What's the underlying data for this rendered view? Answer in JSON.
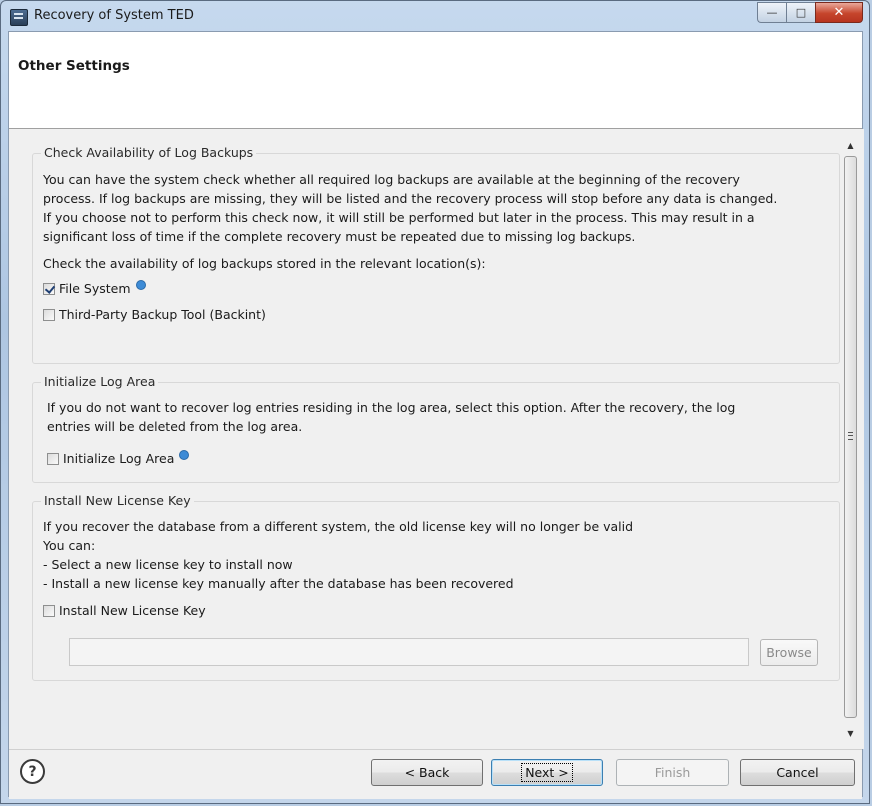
{
  "window": {
    "title": "Recovery of System TED",
    "icon": "database-app-icon"
  },
  "header": {
    "title": "Other Settings"
  },
  "groups": [
    {
      "legend": "Check Availability of Log Backups",
      "description_lines": [
        "You can have the system check whether all required log backups are available at the beginning of the recovery",
        "process. If log backups are missing, they will be listed and the recovery process will stop before any data is changed.",
        "If you choose not to perform this check now, it will still be performed but later in the process. This may result in a",
        "significant loss of time if the complete recovery must be repeated due to missing log backups."
      ],
      "prompt": "Check the availability of log backups stored in the relevant location(s):",
      "options": [
        {
          "label": "File System",
          "checked": true,
          "has_info_icon": true
        },
        {
          "label": "Third-Party Backup Tool (Backint)",
          "checked": false,
          "has_info_icon": false
        }
      ]
    },
    {
      "legend": "Initialize Log Area",
      "description_lines": [
        "If you do not want to recover log entries residing in the log area, select this option. After the recovery, the log",
        "entries will be deleted from the log area."
      ],
      "options": [
        {
          "label": "Initialize Log Area",
          "checked": false,
          "has_info_icon": true
        }
      ]
    },
    {
      "legend": "Install New License Key",
      "description_lines": [
        "If you recover the database from a different system, the old license key will no longer be valid",
        "You can:",
        "- Select a new license key to install now",
        "- Install a new license key manually after the database has been recovered"
      ],
      "options": [
        {
          "label": "Install New License Key",
          "checked": false,
          "has_info_icon": false
        }
      ],
      "path_value": "",
      "browse_label": "Browse"
    }
  ],
  "footer": {
    "back_label": "< Back",
    "next_label": "Next >",
    "finish_label": "Finish",
    "cancel_label": "Cancel"
  },
  "colors": {
    "info_icon": "#3d8bd6",
    "default_button_border": "#3c7fb1",
    "close_button": "#c6452c"
  }
}
